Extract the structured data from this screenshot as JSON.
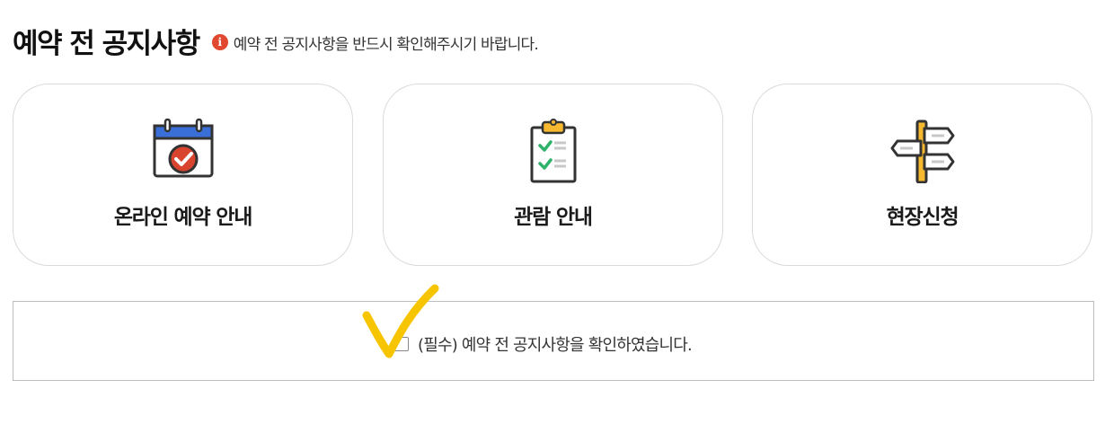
{
  "header": {
    "title": "예약 전 공지사항",
    "notice_icon": "info-icon",
    "notice_text": "예약 전 공지사항을 반드시 확인해주시기 바랍니다."
  },
  "cards": [
    {
      "label": "온라인 예약 안내",
      "icon": "calendar-check-icon"
    },
    {
      "label": "관람 안내",
      "icon": "clipboard-checklist-icon"
    },
    {
      "label": "현장신청",
      "icon": "signpost-icon"
    }
  ],
  "agreement": {
    "label": "(필수) 예약 전 공지사항을 확인하였습니다.",
    "checked": false
  },
  "colors": {
    "notice_icon": "#e0482f",
    "calendar_header": "#3b6fd8",
    "check_red": "#d9442e",
    "clipboard_clip": "#f5b82e",
    "check_green": "#2fb36b",
    "signpost_pole": "#f5b82e",
    "annotation_check": "#f7c400"
  }
}
